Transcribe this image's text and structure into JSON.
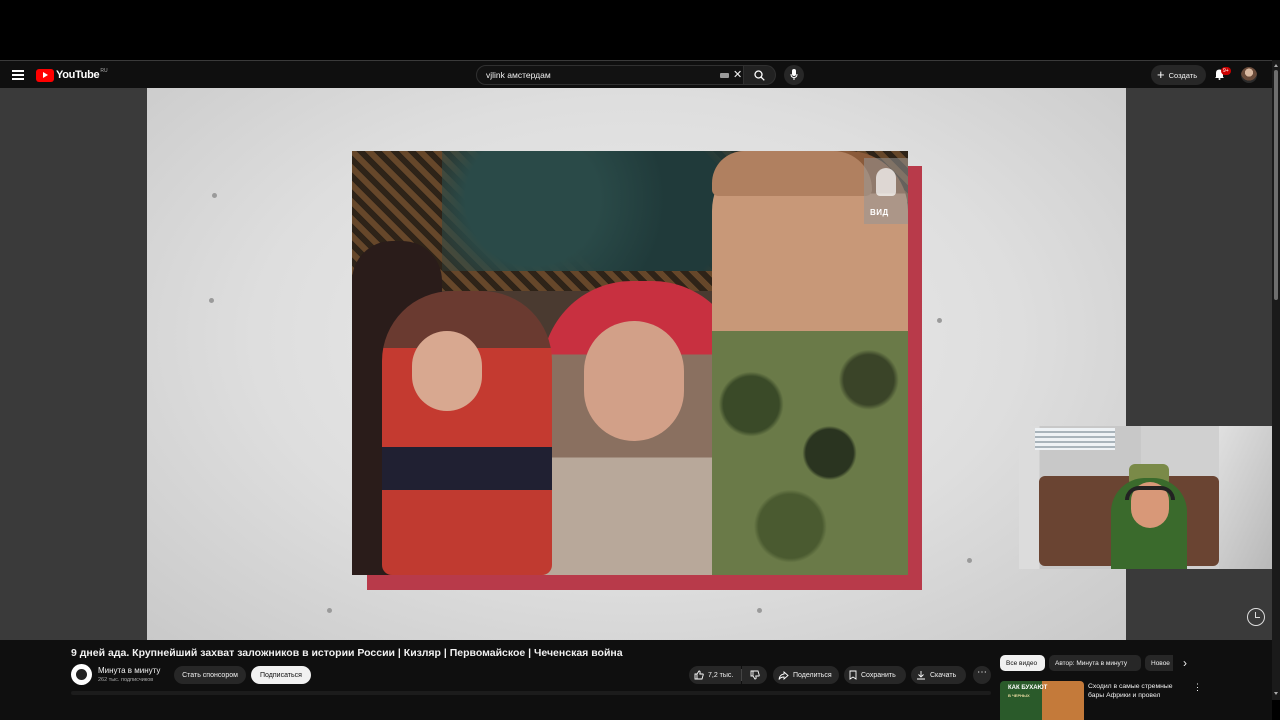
{
  "header": {
    "logo_text": "YouTube",
    "logo_region": "RU",
    "search_value": "vjlink амстердам",
    "create_label": "Создать",
    "notifications_badge": "9+"
  },
  "video": {
    "watermark_text": "ВИД",
    "title": "9 дней ада. Крупнейший захват заложников в истории России | Кизляр | Первомайское | Чеченская война"
  },
  "channel": {
    "name": "Минута в минуту",
    "subscribers": "262 тыс. подписчиков",
    "sponsor_label": "Стать спонсором",
    "subscribe_label": "Подписаться"
  },
  "actions": {
    "likes": "7,2 тыс.",
    "share_label": "Поделиться",
    "save_label": "Сохранить",
    "download_label": "Скачать",
    "more": "⋯"
  },
  "related": {
    "chips": [
      "Все видео",
      "Автор: Минута в минуту",
      "Новое"
    ],
    "items": [
      {
        "thumb_text": "КАК БУХАЮТ",
        "thumb_subtext": "В ЧЕРНЫХ",
        "title": "Сходил в самые стремные бары Африки и провел"
      }
    ]
  },
  "colors": {
    "brand_red": "#ff0000",
    "background": "#0f0f0f",
    "frame_red": "#b83a4a"
  },
  "icons": [
    "menu-icon",
    "youtube-logo",
    "keyboard-icon",
    "clear-icon",
    "search-icon",
    "mic-icon",
    "plus-icon",
    "bell-icon",
    "avatar",
    "clock-icon",
    "thumbs-up-icon",
    "thumbs-down-icon",
    "share-icon",
    "save-icon",
    "download-icon",
    "chevron-right-icon",
    "more-vert-icon"
  ]
}
